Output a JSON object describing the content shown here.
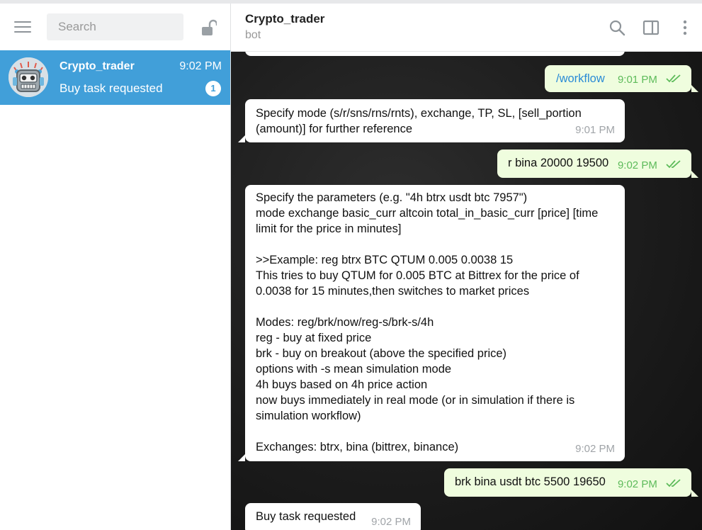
{
  "sidebar": {
    "search_placeholder": "Search",
    "menu_icon": "hamburger-menu-icon",
    "lock_icon": "unlocked-padlock-icon",
    "chats": [
      {
        "name": "Crypto_trader",
        "time": "9:02 PM",
        "last_message": "Buy task requested",
        "unread": "1",
        "avatar_icon": "robot-avatar-icon"
      }
    ]
  },
  "header": {
    "title": "Crypto_trader",
    "status": "bot",
    "icons": [
      "search-icon",
      "sidebar-toggle-icon",
      "more-vertical-icon"
    ]
  },
  "colors": {
    "accent": "#419fd9",
    "outgoing_bubble": "#effdde",
    "incoming_bubble": "#ffffff",
    "outgoing_time": "#5dbb5a",
    "link": "#2a8bd6"
  },
  "messages": [
    {
      "direction": "out",
      "text": "/workflow",
      "time": "9:01 PM",
      "read": true
    },
    {
      "direction": "in",
      "text": "Specify mode (s/r/sns/rns/rnts), exchange, TP, SL, [sell_portion (amount)] for further reference",
      "time": "9:01 PM"
    },
    {
      "direction": "out",
      "text": "r bina 20000 19500",
      "time": "9:02 PM",
      "read": true
    },
    {
      "direction": "in",
      "text": "Specify the parameters (e.g. \"4h btrx usdt btc 7957\")\nmode exchange basic_curr altcoin total_in_basic_curr [price] [time limit for the price in minutes]\n\n>>Example: reg btrx BTC QTUM 0.005 0.0038 15\nThis tries to buy QTUM for 0.005 BTC at Bittrex for the price of 0.0038 for 15 minutes,then switches to market prices\n\nModes: reg/brk/now/reg-s/brk-s/4h\nreg - buy at fixed price\nbrk - buy on breakout (above the specified price)\noptions with -s mean simulation mode\n4h buys based on 4h price action\nnow buys immediately in real mode (or in simulation if there is simulation workflow)\n\nExchanges: btrx, bina (bittrex, binance)",
      "time": "9:02 PM"
    },
    {
      "direction": "out",
      "text": "brk bina usdt btc 5500 19650",
      "time": "9:02 PM",
      "read": true
    },
    {
      "direction": "in",
      "text": "Buy task requested",
      "time": "9:02 PM"
    }
  ]
}
